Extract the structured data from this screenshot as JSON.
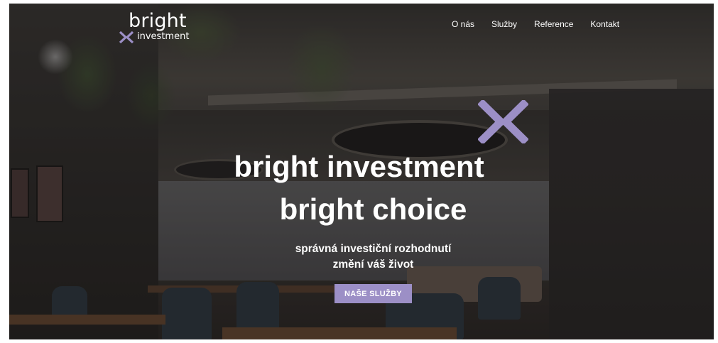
{
  "brand": {
    "name": "bright",
    "subtitle": "investment",
    "accent_color": "#9c8fc6",
    "logo_icon": "x-chevrons-icon"
  },
  "nav": {
    "items": [
      {
        "label": "O nás"
      },
      {
        "label": "Služby"
      },
      {
        "label": "Reference"
      },
      {
        "label": "Kontakt"
      }
    ]
  },
  "hero": {
    "title_line1": "bright investment",
    "title_line2": "bright choice",
    "tagline_line1": "správná investiční rozhodnutí",
    "tagline_line2": "změní váš život",
    "cta_label": "NAŠE SLUŽBY",
    "emblem_icon": "x-chevrons-icon",
    "background": "office-interior-photo"
  }
}
